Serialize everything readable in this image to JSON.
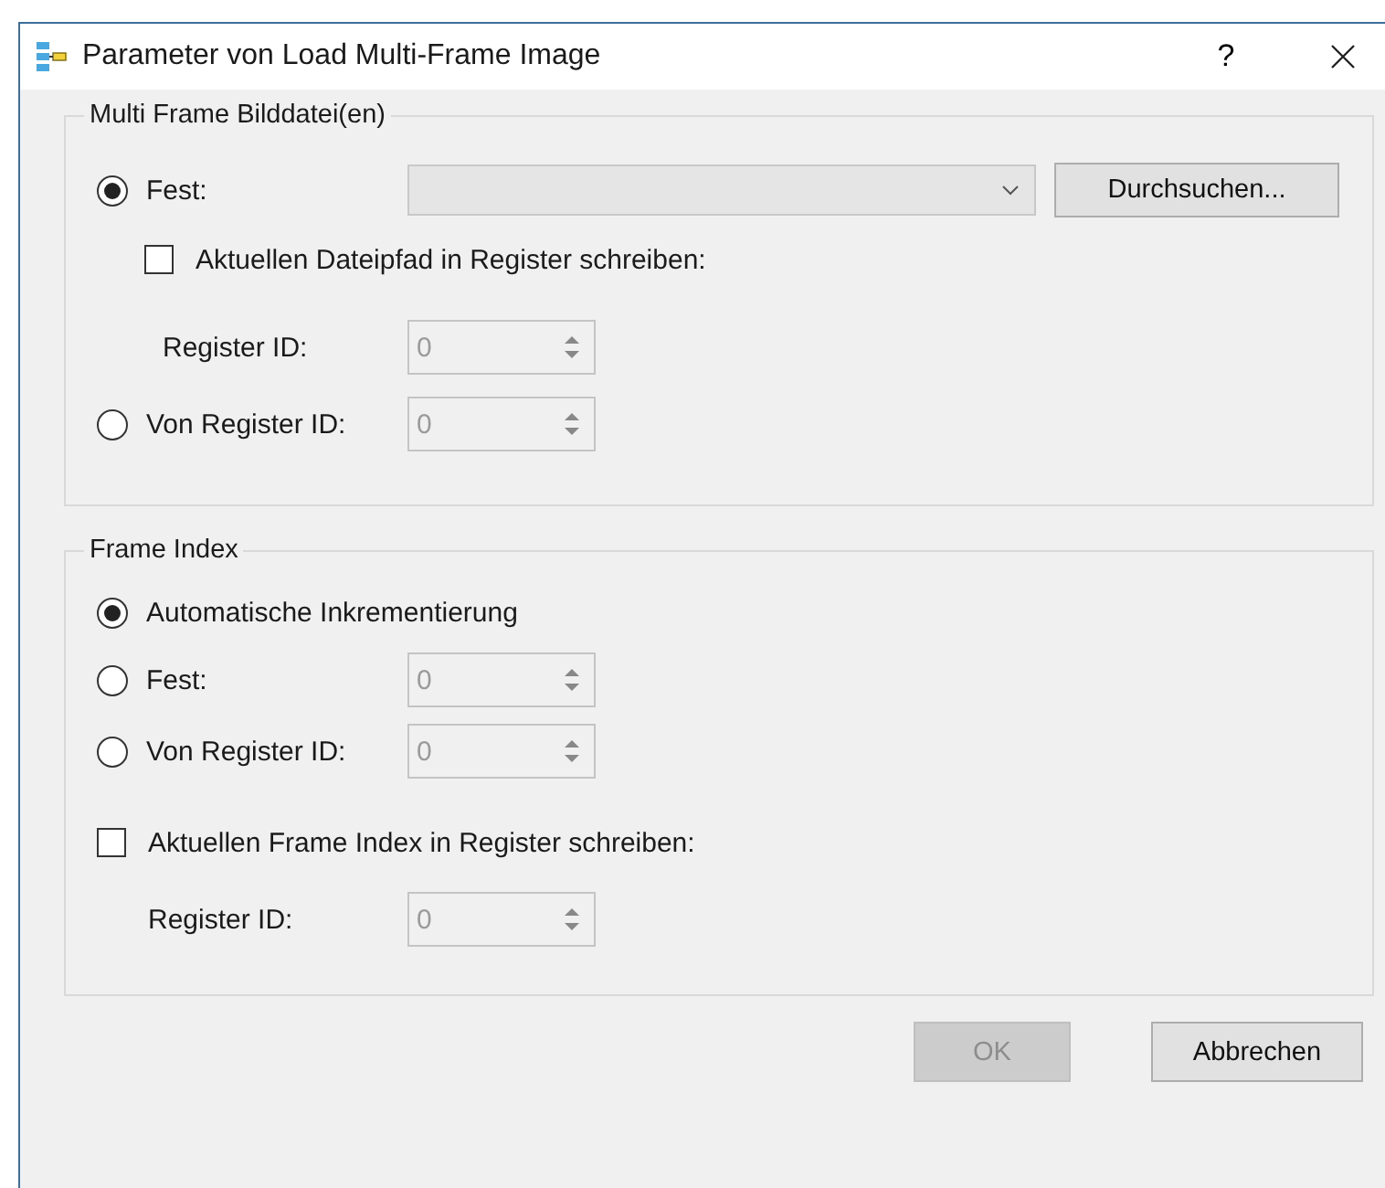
{
  "window": {
    "title": "Parameter von Load Multi-Frame Image",
    "help": "?"
  },
  "groups": [
    {
      "title": "Multi Frame Bilddatei(en)",
      "options": [
        {
          "kind": "radio",
          "label": "Fest:",
          "selected": true,
          "combo": {
            "disabled": true
          },
          "button": "Durchsuchen...",
          "children": [
            {
              "kind": "checkbox",
              "label": "Aktuellen Dateipfad in Register schreiben:",
              "checked": false
            },
            {
              "kind": "field",
              "label": "Register ID:",
              "spin": {
                "value": "0",
                "disabled": true
              }
            }
          ]
        },
        {
          "kind": "radio",
          "label": "Von Register ID:",
          "selected": false,
          "spin": {
            "value": "0",
            "disabled": true
          }
        }
      ]
    },
    {
      "title": "Frame Index",
      "options": [
        {
          "kind": "radio",
          "label": "Automatische Inkrementierung",
          "selected": true
        },
        {
          "kind": "radio",
          "label": "Fest:",
          "selected": false,
          "spin": {
            "value": "0",
            "disabled": true
          }
        },
        {
          "kind": "radio",
          "label": "Von Register ID:",
          "selected": false,
          "spin": {
            "value": "0",
            "disabled": true
          }
        },
        {
          "kind": "checkbox",
          "label": "Aktuellen Frame Index in Register schreiben:",
          "checked": false,
          "children": [
            {
              "kind": "field",
              "label": "Register ID:",
              "spin": {
                "value": "0",
                "disabled": true
              }
            }
          ]
        }
      ]
    }
  ],
  "buttons": [
    {
      "label": "OK",
      "disabled": true
    },
    {
      "label": "Abbrechen",
      "disabled": false
    }
  ]
}
